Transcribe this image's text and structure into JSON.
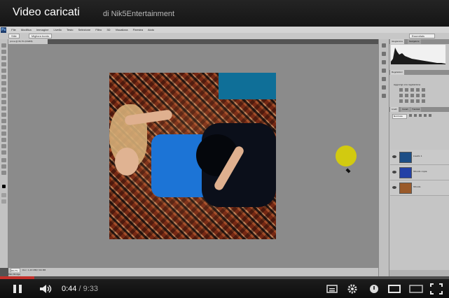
{
  "video": {
    "title": "Video caricati",
    "uploader": "di Nik5Entertainment"
  },
  "player": {
    "current_time": "0:44",
    "separator": "/",
    "duration": "9:33",
    "progress_fraction": 0.077,
    "icons": [
      "pause-icon",
      "volume-icon",
      "captions-icon",
      "settings-icon",
      "watch-later-icon",
      "small-player-icon",
      "large-player-icon",
      "fullscreen-icon"
    ],
    "accent_color": "#c4302b"
  },
  "photoshop": {
    "logo": "Ps",
    "menu": [
      "File",
      "Modifica",
      "Immagine",
      "Livello",
      "Testo",
      "Selezione",
      "Filtro",
      "3D",
      "Visualizza",
      "Finestra",
      "Aiuto"
    ],
    "options_bar": [
      "Stile",
      "Migliora bordo"
    ],
    "workspace": "Essentials",
    "document_tab": "prova @ 66,7% (RGB/8)",
    "zoom": "66,7%",
    "doc_info": "Doc: 1,43 MB/7,80 MB",
    "mini_bridge": "Mini Bridge",
    "panels": {
      "top_tabs": [
        "Istogramma",
        "Navigatore"
      ],
      "adjust_tabs": [
        "Regolazioni"
      ],
      "adjust_title": "Aggiungi una regolazione",
      "layers_tabs": [
        "Livelli",
        "Canali",
        "Tracciati"
      ],
      "blend_mode": "Normale",
      "layers": [
        {
          "name": "Livello 1",
          "thumb": "#1d4e86"
        },
        {
          "name": "Sfondo copia",
          "thumb": "#2340a6"
        },
        {
          "name": "Sfondo",
          "thumb": "#9a5a2a"
        }
      ]
    }
  }
}
